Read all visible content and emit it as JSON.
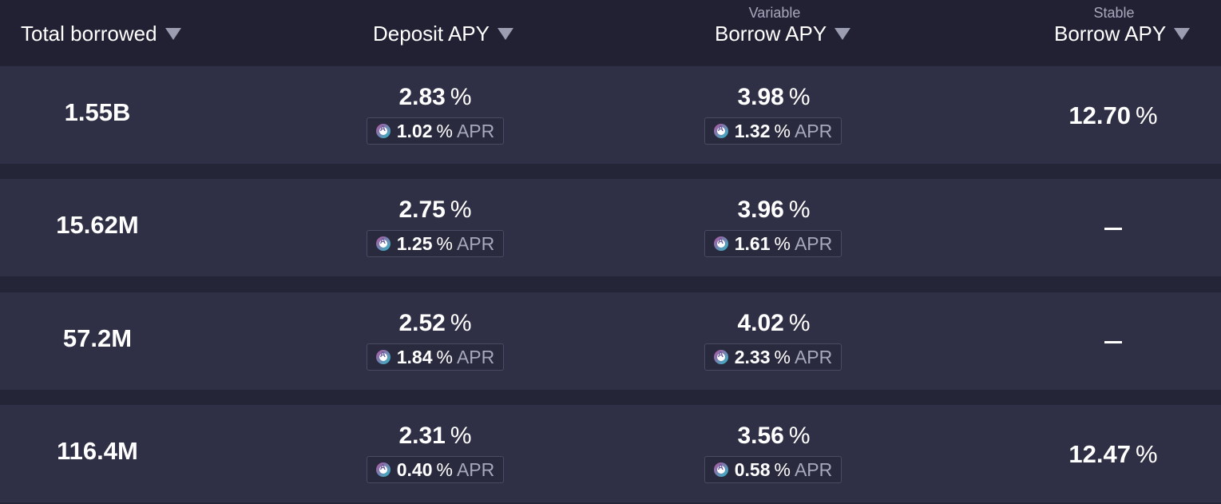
{
  "header": {
    "total_borrowed": "Total borrowed",
    "deposit_apy": "Deposit APY",
    "variable_sub": "Variable",
    "variable_borrow_apy": "Borrow APY",
    "stable_sub": "Stable",
    "stable_borrow_apy": "Borrow APY"
  },
  "pct_sign": "%",
  "apr_label": "APR",
  "rows": [
    {
      "total_borrowed": "1.55B",
      "deposit_apy": "2.83",
      "deposit_apr": "1.02",
      "variable_apy": "3.98",
      "variable_apr": "1.32",
      "stable_apy": "12.70"
    },
    {
      "total_borrowed": "15.62M",
      "deposit_apy": "2.75",
      "deposit_apr": "1.25",
      "variable_apy": "3.96",
      "variable_apr": "1.61",
      "stable_apy": null
    },
    {
      "total_borrowed": "57.2M",
      "deposit_apy": "2.52",
      "deposit_apr": "1.84",
      "variable_apy": "4.02",
      "variable_apr": "2.33",
      "stable_apy": null
    },
    {
      "total_borrowed": "116.4M",
      "deposit_apy": "2.31",
      "deposit_apr": "0.40",
      "variable_apy": "3.56",
      "variable_apr": "0.58",
      "stable_apy": "12.47"
    }
  ],
  "icons": {
    "reward": "aave-token-icon",
    "sort": "sort-caret-icon"
  }
}
